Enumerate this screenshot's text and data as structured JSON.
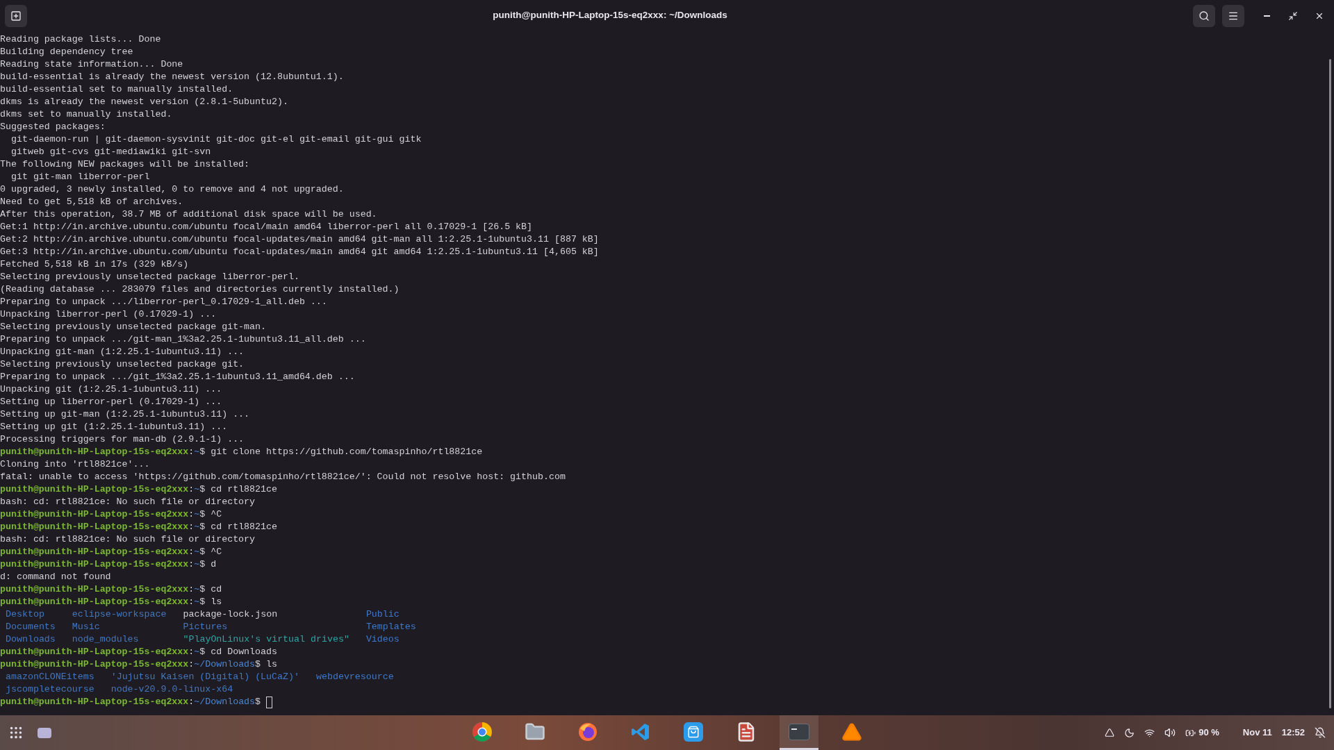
{
  "window": {
    "title": "punith@punith-HP-Laptop-15s-eq2xxx: ~/Downloads"
  },
  "terminal": {
    "lines": [
      {
        "kind": "output",
        "text": "Reading package lists... Done"
      },
      {
        "kind": "output",
        "text": "Building dependency tree"
      },
      {
        "kind": "output",
        "text": "Reading state information... Done"
      },
      {
        "kind": "output",
        "text": "build-essential is already the newest version (12.8ubuntu1.1)."
      },
      {
        "kind": "output",
        "text": "build-essential set to manually installed."
      },
      {
        "kind": "output",
        "text": "dkms is already the newest version (2.8.1-5ubuntu2)."
      },
      {
        "kind": "output",
        "text": "dkms set to manually installed."
      },
      {
        "kind": "output",
        "text": "Suggested packages:"
      },
      {
        "kind": "output",
        "text": "  git-daemon-run | git-daemon-sysvinit git-doc git-el git-email git-gui gitk"
      },
      {
        "kind": "output",
        "text": "  gitweb git-cvs git-mediawiki git-svn"
      },
      {
        "kind": "output",
        "text": "The following NEW packages will be installed:"
      },
      {
        "kind": "output",
        "text": "  git git-man liberror-perl"
      },
      {
        "kind": "output",
        "text": "0 upgraded, 3 newly installed, 0 to remove and 4 not upgraded."
      },
      {
        "kind": "output",
        "text": "Need to get 5,518 kB of archives."
      },
      {
        "kind": "output",
        "text": "After this operation, 38.7 MB of additional disk space will be used."
      },
      {
        "kind": "output",
        "text": "Get:1 http://in.archive.ubuntu.com/ubuntu focal/main amd64 liberror-perl all 0.17029-1 [26.5 kB]"
      },
      {
        "kind": "output",
        "text": "Get:2 http://in.archive.ubuntu.com/ubuntu focal-updates/main amd64 git-man all 1:2.25.1-1ubuntu3.11 [887 kB]"
      },
      {
        "kind": "output",
        "text": "Get:3 http://in.archive.ubuntu.com/ubuntu focal-updates/main amd64 git amd64 1:2.25.1-1ubuntu3.11 [4,605 kB]"
      },
      {
        "kind": "output",
        "text": "Fetched 5,518 kB in 17s (329 kB/s)"
      },
      {
        "kind": "output",
        "text": "Selecting previously unselected package liberror-perl."
      },
      {
        "kind": "output",
        "text": "(Reading database ... 283079 files and directories currently installed.)"
      },
      {
        "kind": "output",
        "text": "Preparing to unpack .../liberror-perl_0.17029-1_all.deb ..."
      },
      {
        "kind": "output",
        "text": "Unpacking liberror-perl (0.17029-1) ..."
      },
      {
        "kind": "output",
        "text": "Selecting previously unselected package git-man."
      },
      {
        "kind": "output",
        "text": "Preparing to unpack .../git-man_1%3a2.25.1-1ubuntu3.11_all.deb ..."
      },
      {
        "kind": "output",
        "text": "Unpacking git-man (1:2.25.1-1ubuntu3.11) ..."
      },
      {
        "kind": "output",
        "text": "Selecting previously unselected package git."
      },
      {
        "kind": "output",
        "text": "Preparing to unpack .../git_1%3a2.25.1-1ubuntu3.11_amd64.deb ..."
      },
      {
        "kind": "output",
        "text": "Unpacking git (1:2.25.1-1ubuntu3.11) ..."
      },
      {
        "kind": "output",
        "text": "Setting up liberror-perl (0.17029-1) ..."
      },
      {
        "kind": "output",
        "text": "Setting up git-man (1:2.25.1-1ubuntu3.11) ..."
      },
      {
        "kind": "output",
        "text": "Setting up git (1:2.25.1-1ubuntu3.11) ..."
      },
      {
        "kind": "output",
        "text": "Processing triggers for man-db (2.9.1-1) ..."
      },
      {
        "kind": "prompt",
        "user": "punith@punith-HP-Laptop-15s-eq2xxx",
        "sep": ":",
        "path": "~",
        "symbol": "$",
        "command": "git clone https://github.com/tomaspinho/rtl8821ce"
      },
      {
        "kind": "output",
        "text": "Cloning into 'rtl8821ce'..."
      },
      {
        "kind": "output",
        "text": "fatal: unable to access 'https://github.com/tomaspinho/rtl8821ce/': Could not resolve host: github.com"
      },
      {
        "kind": "prompt",
        "user": "punith@punith-HP-Laptop-15s-eq2xxx",
        "sep": ":",
        "path": "~",
        "symbol": "$",
        "command": "cd rtl8821ce"
      },
      {
        "kind": "output",
        "text": "bash: cd: rtl8821ce: No such file or directory"
      },
      {
        "kind": "prompt",
        "user": "punith@punith-HP-Laptop-15s-eq2xxx",
        "sep": ":",
        "path": "~",
        "symbol": "$",
        "command": "^C"
      },
      {
        "kind": "prompt",
        "user": "punith@punith-HP-Laptop-15s-eq2xxx",
        "sep": ":",
        "path": "~",
        "symbol": "$",
        "command": "cd rtl8821ce"
      },
      {
        "kind": "output",
        "text": "bash: cd: rtl8821ce: No such file or directory"
      },
      {
        "kind": "prompt",
        "user": "punith@punith-HP-Laptop-15s-eq2xxx",
        "sep": ":",
        "path": "~",
        "symbol": "$",
        "command": "^C"
      },
      {
        "kind": "prompt",
        "user": "punith@punith-HP-Laptop-15s-eq2xxx",
        "sep": ":",
        "path": "~",
        "symbol": "$",
        "command": "d"
      },
      {
        "kind": "output",
        "text": "d: command not found"
      },
      {
        "kind": "prompt",
        "user": "punith@punith-HP-Laptop-15s-eq2xxx",
        "sep": ":",
        "path": "~",
        "symbol": "$",
        "command": "cd"
      },
      {
        "kind": "prompt",
        "user": "punith@punith-HP-Laptop-15s-eq2xxx",
        "sep": ":",
        "path": "~",
        "symbol": "$",
        "command": "ls"
      },
      {
        "kind": "listing",
        "rows": [
          [
            {
              "text": "Desktop",
              "kind": "dir"
            },
            {
              "text": "eclipse-workspace",
              "kind": "dir"
            },
            {
              "text": "package-lock.json",
              "kind": "file"
            },
            {
              "text": "Public",
              "kind": "dir"
            }
          ],
          [
            {
              "text": "Documents",
              "kind": "dir"
            },
            {
              "text": "Music",
              "kind": "dir"
            },
            {
              "text": "Pictures",
              "kind": "dir"
            },
            {
              "text": "Templates",
              "kind": "dir"
            }
          ],
          [
            {
              "text": "Downloads",
              "kind": "dir"
            },
            {
              "text": "node_modules",
              "kind": "dir"
            },
            {
              "text": "\"PlayOnLinux's virtual drives\"",
              "kind": "special"
            },
            {
              "text": "Videos",
              "kind": "dir"
            }
          ]
        ]
      },
      {
        "kind": "prompt",
        "user": "punith@punith-HP-Laptop-15s-eq2xxx",
        "sep": ":",
        "path": "~",
        "symbol": "$",
        "command": "cd Downloads"
      },
      {
        "kind": "prompt",
        "user": "punith@punith-HP-Laptop-15s-eq2xxx",
        "sep": ":",
        "path": "~/Downloads",
        "symbol": "$",
        "command": "ls"
      },
      {
        "kind": "listing",
        "rows": [
          [
            {
              "text": "amazonCLONEitems",
              "kind": "dir"
            },
            {
              "text": "'Jujutsu Kaisen (Digital) (LuCaZ)'",
              "kind": "dir"
            },
            {
              "text": "webdevresource",
              "kind": "dir"
            }
          ],
          [
            {
              "text": "jscompletecourse",
              "kind": "dir"
            },
            {
              "text": "node-v20.9.0-linux-x64",
              "kind": "dir"
            }
          ]
        ]
      },
      {
        "kind": "prompt",
        "user": "punith@punith-HP-Laptop-15s-eq2xxx",
        "sep": ":",
        "path": "~/Downloads",
        "symbol": "$",
        "cursor": true
      }
    ]
  },
  "dock": [
    {
      "kind": "chrome",
      "selected": false
    },
    {
      "kind": "files",
      "selected": false
    },
    {
      "kind": "firefox",
      "selected": false
    },
    {
      "kind": "vscode",
      "selected": false
    },
    {
      "kind": "store",
      "selected": false
    },
    {
      "kind": "editor",
      "selected": false
    },
    {
      "kind": "terminal",
      "selected": true
    },
    {
      "kind": "vlc",
      "selected": false
    }
  ],
  "tray": {
    "battery": "90 %",
    "date": "Nov 11",
    "time": "12:52"
  }
}
